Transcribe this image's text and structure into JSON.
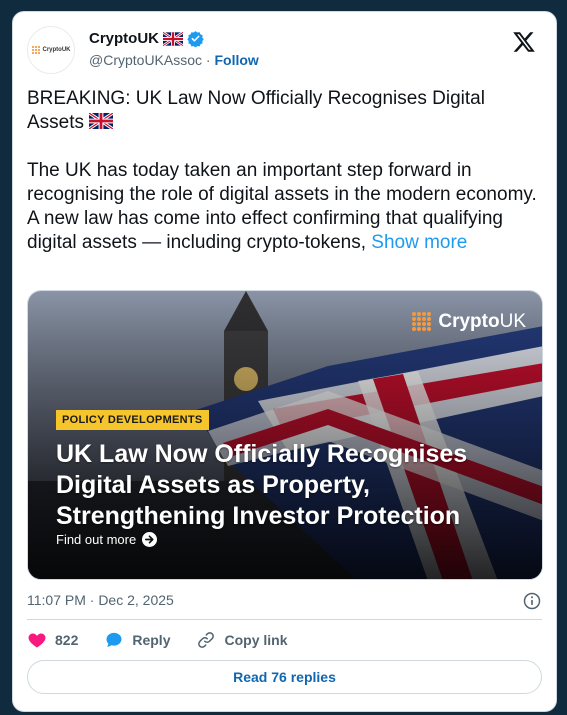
{
  "author": {
    "display_name": "CryptoUK",
    "handle": "@CryptoUKAssoc",
    "separator": " · ",
    "follow_label": "Follow",
    "avatar_text": "CryptoUK"
  },
  "tweet": {
    "headline": "BREAKING: UK Law Now Officially Recognises Digital Assets",
    "body": "The UK has today taken an important step forward in recognising the role of digital assets in the modern economy. A new law has come into effect confirming that qualifying digital assets — including crypto-tokens, ",
    "show_more": "Show more"
  },
  "media": {
    "brand_name": "Crypto",
    "brand_suffix": "UK",
    "tag": "POLICY DEVELOPMENTS",
    "headline": "UK Law Now Officially Recognises Digital Assets as Property, Strengthening Investor Protection",
    "cta": "Find out more"
  },
  "meta": {
    "timestamp": "11:07 PM · Dec 2, 2025"
  },
  "actions": {
    "like_count": "822",
    "reply_label": "Reply",
    "copy_link_label": "Copy link"
  },
  "replies_button": "Read 76 replies",
  "colors": {
    "background": "#0f2b3d",
    "like": "#f91880",
    "reply": "#1d9bf0",
    "link": "#0f67b1",
    "verified": "#1d9bf0",
    "tag": "#f6c52b",
    "brand_orange": "#f59a3c"
  },
  "icons": {
    "verified": "verified-badge-icon",
    "flag": "uk-flag-icon",
    "logo": "x-logo-icon",
    "info": "info-icon",
    "like": "heart-icon",
    "reply": "speech-bubble-icon",
    "copy": "link-icon",
    "cta": "arrow-right-icon"
  }
}
